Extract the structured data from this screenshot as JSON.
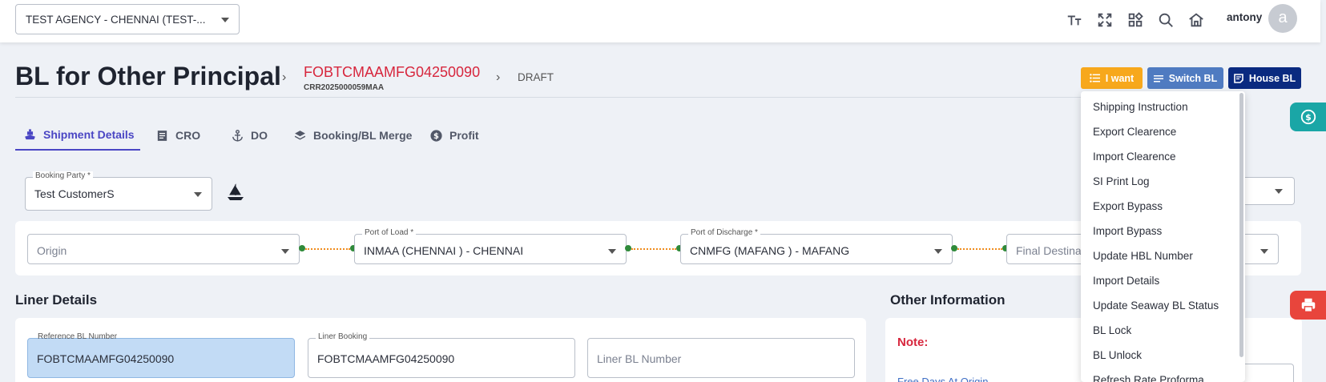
{
  "header": {
    "agency": "TEST AGENCY - CHENNAI  (TEST-...",
    "user": "antony",
    "avatar_initial": "a",
    "icons": [
      "text-size-icon",
      "fullscreen-icon",
      "apps-icon",
      "search-icon",
      "home-icon"
    ]
  },
  "page": {
    "title": "BL for Other Principal",
    "bl_number": "FOBTCMAAMFG04250090",
    "bl_sub": "CRR2025000059MAA",
    "status": "DRAFT",
    "separator": "›"
  },
  "actions": {
    "i_want": "I want",
    "switch_bl": "Switch BL",
    "house_bl": "House BL"
  },
  "i_want_menu": [
    "Shipping Instruction",
    "Export Clearence",
    "Import Clearence",
    "SI Print Log",
    "Export Bypass",
    "Import Bypass",
    "Update HBL Number",
    "Import Details",
    "Update Seaway BL Status",
    "BL Lock",
    "BL Unlock",
    "Refresh Rate Proforma"
  ],
  "tabs": [
    {
      "label": "Shipment Details",
      "icon": "ship-icon",
      "active": true
    },
    {
      "label": "CRO",
      "icon": "document-icon",
      "active": false
    },
    {
      "label": "DO",
      "icon": "anchor-icon",
      "active": false
    },
    {
      "label": "Booking/BL Merge",
      "icon": "layers-icon",
      "active": false
    },
    {
      "label": "Profit",
      "icon": "dollar-icon",
      "active": false
    }
  ],
  "booking_party": {
    "label": "Booking Party *",
    "value": "Test CustomerS"
  },
  "route": {
    "origin": {
      "placeholder": "Origin"
    },
    "port_of_load": {
      "label": "Port of Load *",
      "value": "INMAA (CHENNAI ) - CHENNAI"
    },
    "port_of_discharge": {
      "label": "Port of Discharge *",
      "value": "CNMFG (MAFANG ) - MAFANG"
    },
    "final_destination": {
      "placeholder": "Final Destina"
    }
  },
  "liner_details": {
    "title": "Liner Details",
    "reference_bl": {
      "label": "Reference BL Number",
      "value": "FOBTCMAAMFG04250090"
    },
    "liner_booking": {
      "label": "Liner Booking",
      "value": "FOBTCMAAMFG04250090"
    },
    "liner_bl": {
      "placeholder": "Liner BL Number"
    }
  },
  "other_information": {
    "title": "Other Information",
    "note": "Note:",
    "free_days": "Free Days At Origin"
  },
  "colors": {
    "primary": "#4a46c4",
    "i_want": "#f7a81c",
    "switch_bl": "#4f7bc1",
    "house_bl": "#0a2a80",
    "bl_number": "#d7263d",
    "float_currency": "#1aa6a6",
    "float_print": "#e8453c"
  }
}
